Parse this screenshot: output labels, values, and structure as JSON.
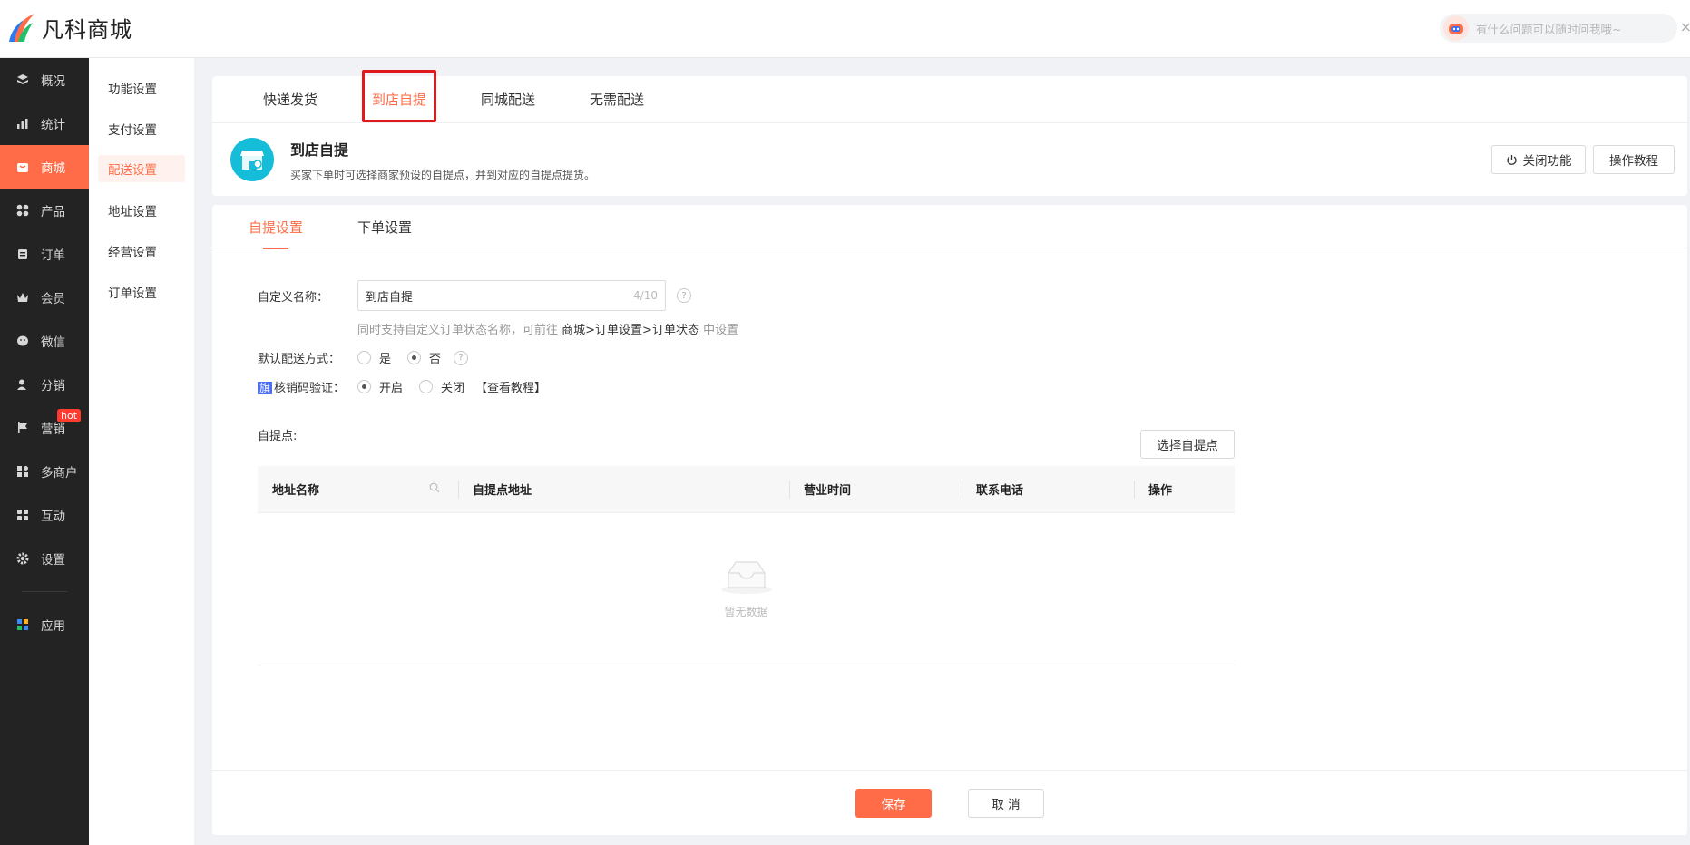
{
  "header": {
    "brand": "凡科商城",
    "assistant_placeholder": "有什么问题可以随时问我哦~",
    "close_glyph": "×"
  },
  "left_nav": {
    "items": [
      {
        "label": "概况",
        "icon": "layers-icon"
      },
      {
        "label": "统计",
        "icon": "chart-icon"
      },
      {
        "label": "商城",
        "icon": "shop-icon"
      },
      {
        "label": "产品",
        "icon": "grid-icon"
      },
      {
        "label": "订单",
        "icon": "clipboard-icon"
      },
      {
        "label": "会员",
        "icon": "crown-icon"
      },
      {
        "label": "微信",
        "icon": "wechat-icon"
      },
      {
        "label": "分销",
        "icon": "user-icon"
      },
      {
        "label": "营销",
        "icon": "flag-icon",
        "badge": "hot"
      },
      {
        "label": "多商户",
        "icon": "store-icon"
      },
      {
        "label": "互动",
        "icon": "puzzle-icon"
      },
      {
        "label": "设置",
        "icon": "gear-icon"
      },
      {
        "label": "应用",
        "icon": "apps-icon"
      }
    ],
    "active": "商城"
  },
  "sub_nav": {
    "items": [
      "功能设置",
      "支付设置",
      "配送设置",
      "地址设置",
      "经营设置",
      "订单设置"
    ],
    "active": "配送设置"
  },
  "delivery_tabs": [
    "快递发货",
    "到店自提",
    "同城配送",
    "无需配送"
  ],
  "intro": {
    "title": "到店自提",
    "desc": "买家下单时可选择商家预设的自提点，并到对应的自提点提货。",
    "close_btn": "关闭功能",
    "tutorial_btn": "操作教程"
  },
  "settings_tabs": [
    "自提设置",
    "下单设置"
  ],
  "form": {
    "name_label": "自定义名称：",
    "name_value": "到店自提",
    "name_count": "4/10",
    "hint_prefix": "同时支持自定义订单状态名称，可前往",
    "hint_link": "商城>订单设置>订单状态",
    "hint_suffix": "中设置",
    "default_label": "默认配送方式：",
    "yes": "是",
    "no": "否",
    "flag": "旗",
    "verify_label": "核销码验证：",
    "on": "开启",
    "off": "关闭",
    "view_tutorial": "【查看教程】",
    "points_label": "自提点:",
    "select_btn": "选择自提点"
  },
  "table": {
    "headers": [
      "地址名称",
      "自提点地址",
      "营业时间",
      "联系电话",
      "操作"
    ],
    "empty": "暂无数据"
  },
  "footer": {
    "save": "保存",
    "cancel": "取 消"
  },
  "colors": {
    "accent": "#ff6c47",
    "nav_bg": "#232323",
    "highlight_border": "#e0191e",
    "intro_icon_bg": "#16bdd8"
  }
}
